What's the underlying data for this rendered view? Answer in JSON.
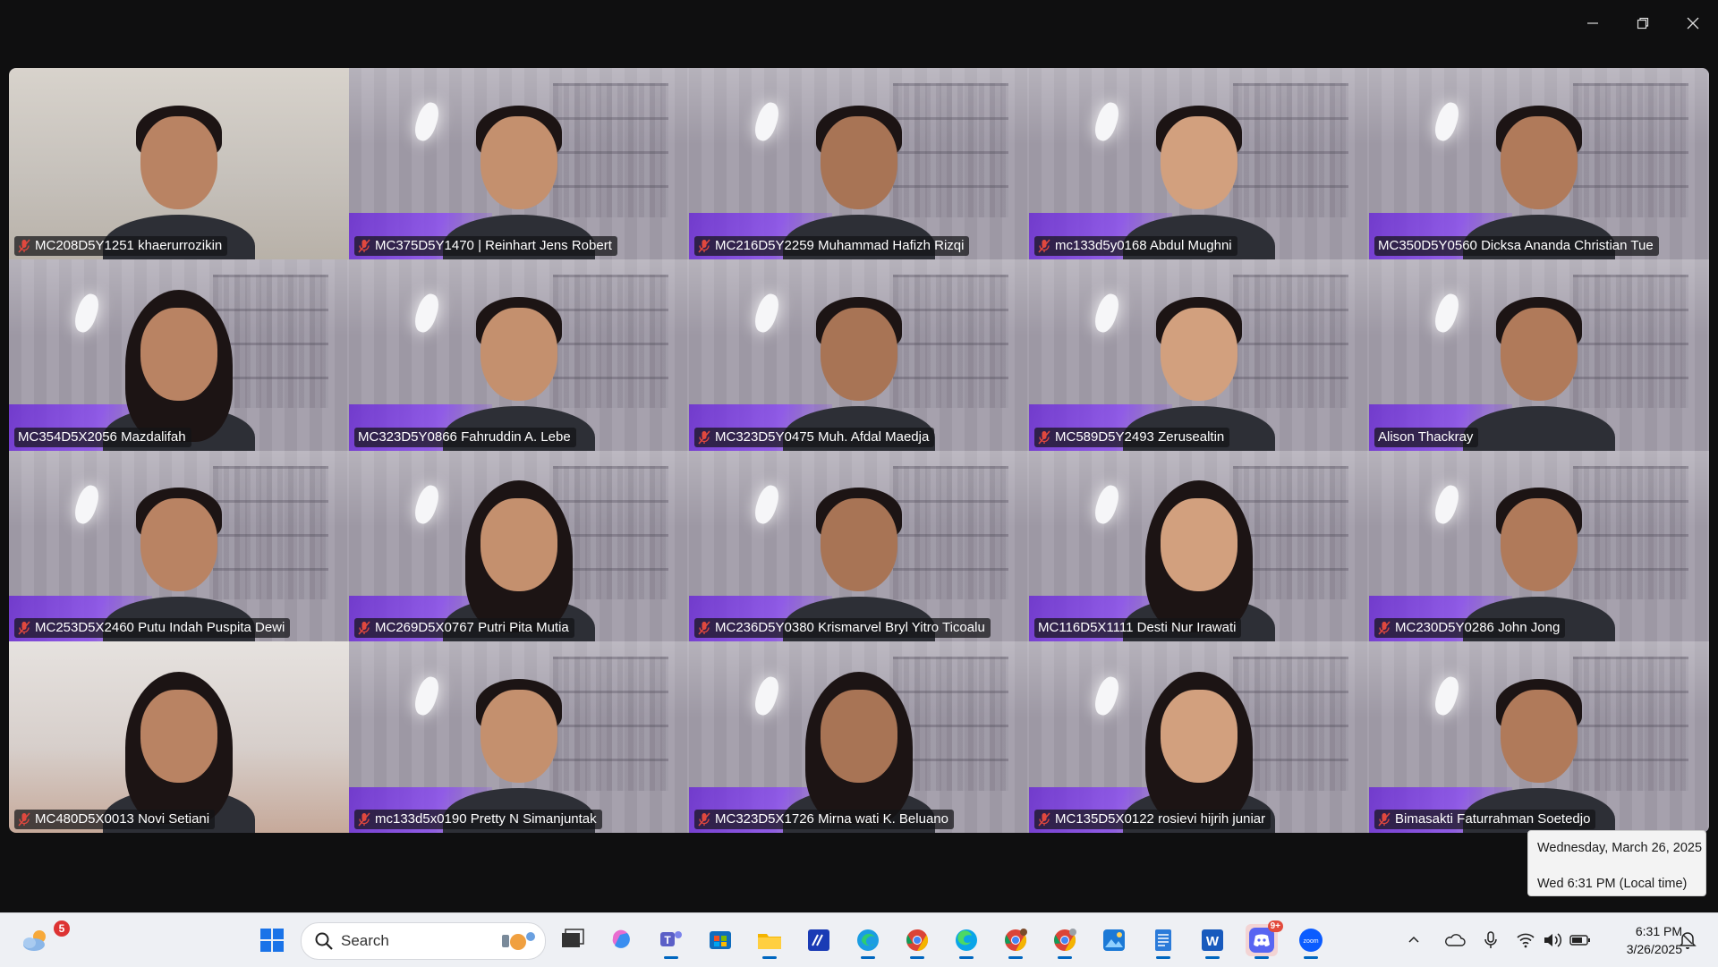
{
  "window": {
    "controls": [
      "minimize-icon",
      "restore-icon",
      "close-icon"
    ]
  },
  "participants": [
    {
      "name": "MC208D5Y1251 khaerurrozikin",
      "muted": true,
      "scene": "wall"
    },
    {
      "name": "MC375D5Y1470 | Reinhart Jens Robert",
      "muted": true,
      "scene": "virtual"
    },
    {
      "name": "MC216D5Y2259 Muhammad Hafizh Rizqi",
      "muted": true,
      "scene": "virtual"
    },
    {
      "name": "mc133d5y0168 Abdul Mughni",
      "muted": true,
      "scene": "virtual"
    },
    {
      "name": "MC350D5Y0560 Dicksa Ananda Christian Tue",
      "muted": false,
      "scene": "virtual"
    },
    {
      "name": "MC354D5X2056 Mazdalifah",
      "muted": false,
      "scene": "virtual"
    },
    {
      "name": "MC323D5Y0866 Fahruddin A. Lebe",
      "muted": false,
      "scene": "virtual"
    },
    {
      "name": "MC323D5Y0475 Muh. Afdal Maedja",
      "muted": true,
      "scene": "virtual"
    },
    {
      "name": "MC589D5Y2493 Zerusealtin",
      "muted": true,
      "scene": "virtual"
    },
    {
      "name": "Alison Thackray",
      "muted": false,
      "scene": "virtual",
      "active_speaker": true
    },
    {
      "name": "MC253D5X2460 Putu Indah Puspita Dewi",
      "muted": true,
      "scene": "virtual"
    },
    {
      "name": "MC269D5X0767 Putri Pita Mutia",
      "muted": true,
      "scene": "virtual"
    },
    {
      "name": "MC236D5Y0380 Krismarvel Bryl Yitro Ticoalu",
      "muted": true,
      "scene": "virtual"
    },
    {
      "name": "MC116D5X1111 Desti Nur Irawati",
      "muted": false,
      "scene": "virtual"
    },
    {
      "name": "MC230D5Y0286 John Jong",
      "muted": true,
      "scene": "virtual"
    },
    {
      "name": "MC480D5X0013 Novi Setiani",
      "muted": true,
      "scene": "room"
    },
    {
      "name": "mc133d5x0190 Pretty N Simanjuntak",
      "muted": true,
      "scene": "virtual"
    },
    {
      "name": "MC323D5X1726 Mirna wati K. Beluano",
      "muted": true,
      "scene": "virtual"
    },
    {
      "name": "MC135D5X0122 rosievi hijrih juniar",
      "muted": true,
      "scene": "virtual"
    },
    {
      "name": "Bimasakti Faturrahman Soetedjo",
      "muted": true,
      "scene": "virtual"
    }
  ],
  "date_tooltip": {
    "line1": "Wednesday, March 26, 2025",
    "line2": "Wed 6:31 PM (Local time)"
  },
  "taskbar": {
    "weather_badge": "5",
    "search_placeholder": "Search",
    "apps": [
      "start-icon",
      "task-view-icon",
      "copilot-icon",
      "teams-icon",
      "store-icon",
      "file-explorer-icon",
      "app-icon",
      "edge-icon",
      "chrome-icon",
      "edge-beta-icon",
      "chrome-profile-icon",
      "chrome-profile-2-icon",
      "photos-icon",
      "notepad-icon",
      "word-icon",
      "discord-icon",
      "zoom-icon"
    ],
    "discord_badge": "9+",
    "clock_time": "6:31 PM",
    "clock_date": "3/26/2025"
  },
  "colors": {
    "active_speaker_border": "#2bdc8b",
    "mute_icon": "#e0483e",
    "virtual_bg_banner": "#7a3ce6"
  }
}
